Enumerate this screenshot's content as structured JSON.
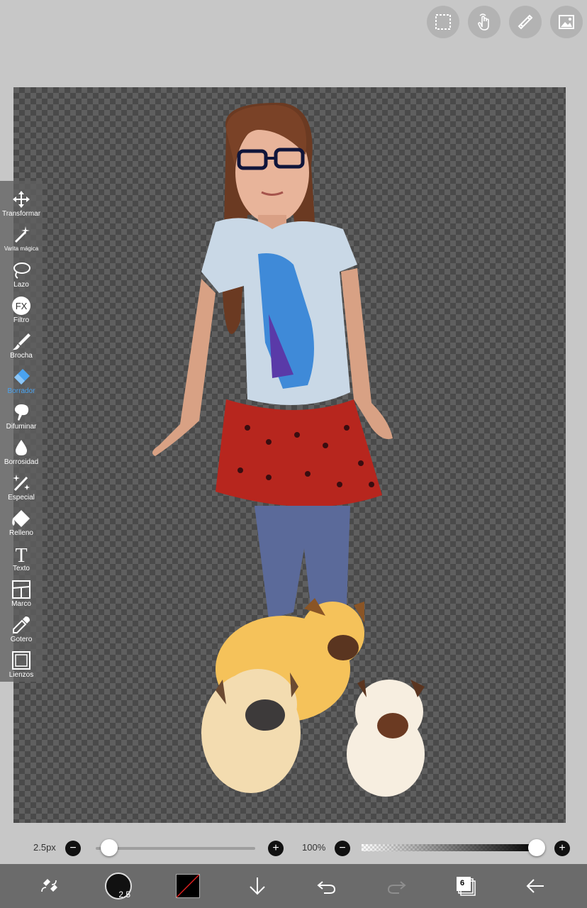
{
  "top_actions": [
    {
      "name": "selection-icon"
    },
    {
      "name": "hand-gesture-icon"
    },
    {
      "name": "ruler-icon"
    },
    {
      "name": "image-icon"
    }
  ],
  "toolbar": {
    "tools": [
      {
        "label": "Transformar",
        "icon": "move-arrows-icon"
      },
      {
        "label": "Varita mágica",
        "icon": "magic-wand-icon"
      },
      {
        "label": "Lazo",
        "icon": "lasso-icon"
      },
      {
        "label": "Filtro",
        "icon": "fx-icon"
      },
      {
        "label": "Brocha",
        "icon": "brush-icon"
      },
      {
        "label": "Borrador",
        "icon": "eraser-icon",
        "active": true
      },
      {
        "label": "Difuminar",
        "icon": "smudge-icon"
      },
      {
        "label": "Borrosidad",
        "icon": "blur-drop-icon"
      },
      {
        "label": "Especial",
        "icon": "special-wand-icon"
      },
      {
        "label": "Relleno",
        "icon": "fill-bucket-icon"
      },
      {
        "label": "Texto",
        "icon": "text-icon"
      },
      {
        "label": "Marco",
        "icon": "frame-icon"
      },
      {
        "label": "Gotero",
        "icon": "eyedropper-icon"
      },
      {
        "label": "Lienzos",
        "icon": "canvas-icon"
      }
    ],
    "active_color": "#4aa3f0"
  },
  "brush_size": {
    "value_label": "2.5px",
    "minus": "−",
    "plus": "+",
    "level": 0.03
  },
  "opacity": {
    "value_label": "100%",
    "minus": "−",
    "plus": "+",
    "level": 1.0
  },
  "bottom_bar": {
    "brush_size_badge": "2.5",
    "layers_count": "6",
    "tools": [
      "swap-tool-icon",
      "brush-size-icon",
      "color-swatch",
      "download-icon",
      "undo-icon",
      "redo-icon",
      "layers-icon",
      "back-arrow-icon"
    ]
  },
  "colors": {
    "toolbar_bg": "#5f5f5f",
    "bottom_bar_bg": "#6b6b6b",
    "page_bg": "#c7c7c7"
  }
}
